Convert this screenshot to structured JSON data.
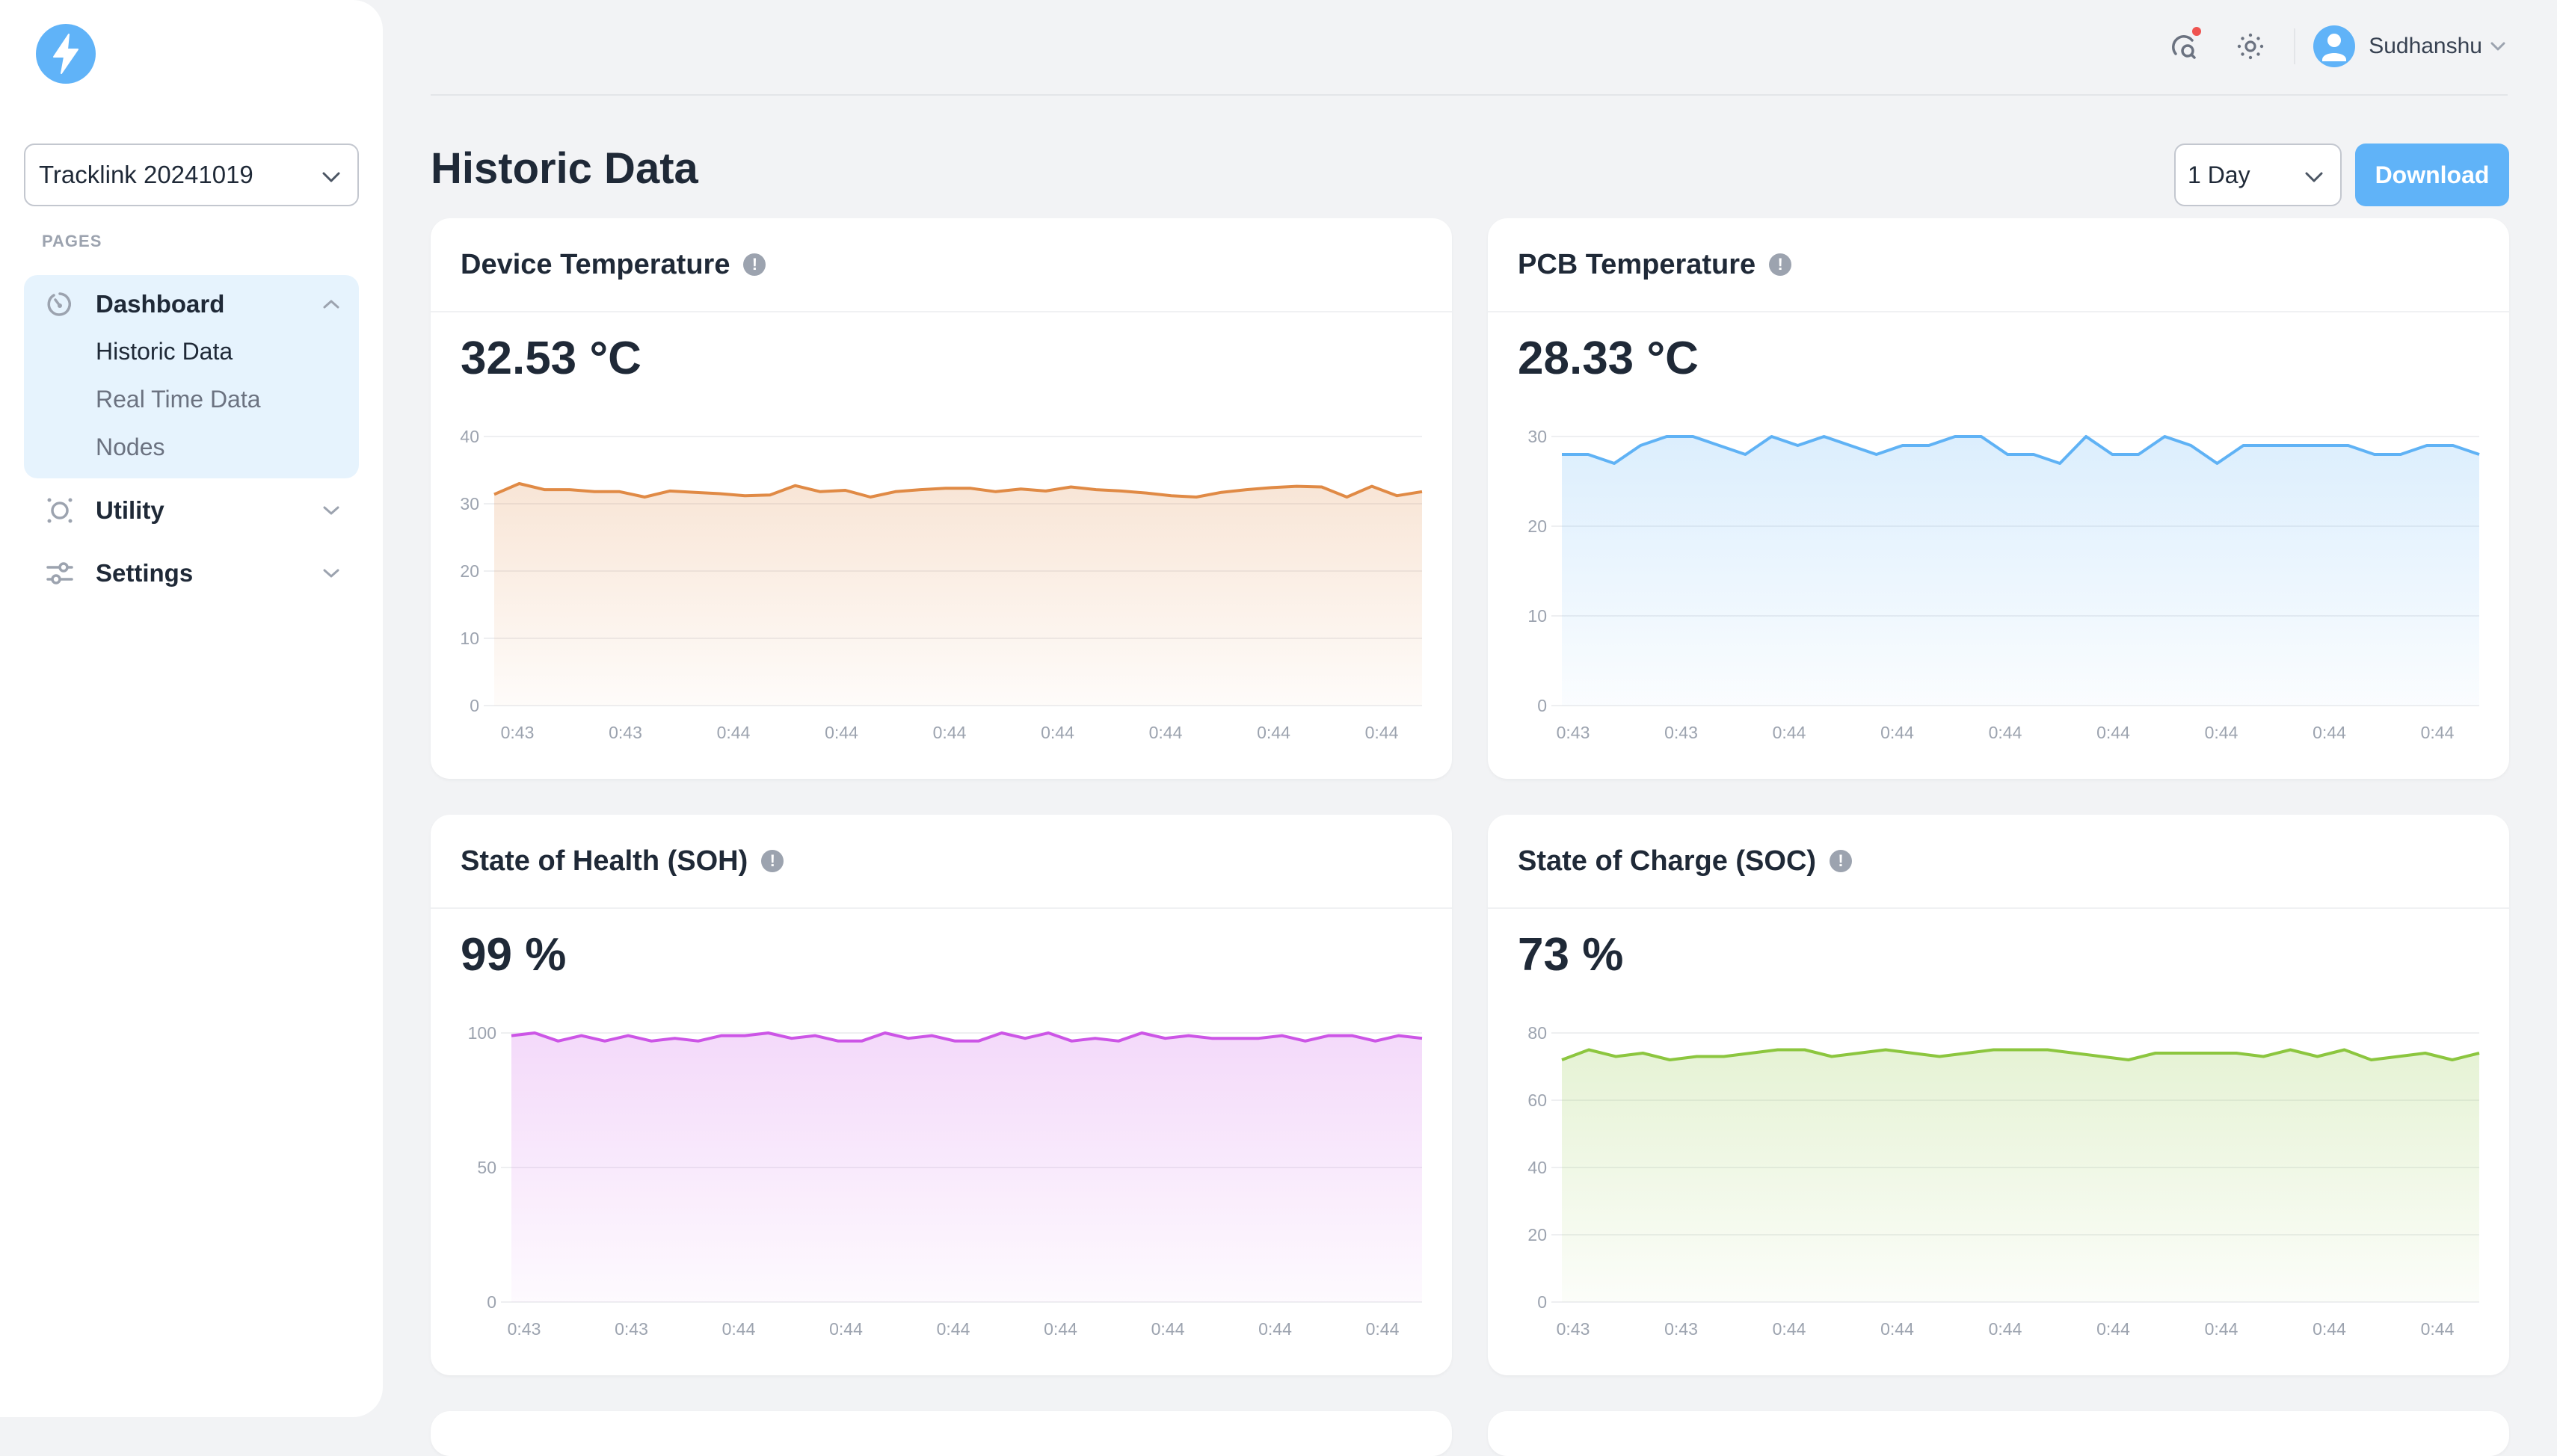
{
  "sidebar": {
    "logo_icon": "lightning-bolt-icon",
    "project_select": {
      "value": "Tracklink 20241019"
    },
    "section_label": "PAGES",
    "nav": [
      {
        "label": "Dashboard",
        "icon": "dashboard-gauge-icon",
        "expanded": true,
        "children": [
          {
            "label": "Historic Data",
            "active": true
          },
          {
            "label": "Real Time Data",
            "active": false
          },
          {
            "label": "Nodes",
            "active": false
          }
        ]
      },
      {
        "label": "Utility",
        "icon": "utility-icon",
        "expanded": false
      },
      {
        "label": "Settings",
        "icon": "sliders-icon",
        "expanded": false
      }
    ]
  },
  "topbar": {
    "user_name": "Sudhanshu",
    "notification_badge": true
  },
  "page": {
    "title": "Historic Data",
    "range_select": {
      "value": "1 Day"
    },
    "download_label": "Download"
  },
  "colors": {
    "accent": "#60b3f8",
    "device_temp": "#e08a45",
    "pcb_temp": "#5fb2f5",
    "soh": "#cc55e6",
    "soc": "#8cc63f"
  },
  "cards": [
    {
      "title": "Device Temperature",
      "value": "32.53 °C"
    },
    {
      "title": "PCB Temperature",
      "value": "28.33 °C"
    },
    {
      "title": "State of Health (SOH)",
      "value": "99 %"
    },
    {
      "title": "State of Charge (SOC)",
      "value": "73 %"
    }
  ],
  "chart_data": [
    {
      "type": "area",
      "title": "Device Temperature",
      "xlabel": "",
      "ylabel": "",
      "ylim": [
        0,
        40
      ],
      "yticks": [
        0,
        10,
        20,
        30,
        40
      ],
      "x_tick_labels": [
        "0:43",
        "0:43",
        "0:44",
        "0:44",
        "0:44",
        "0:44",
        "0:44",
        "0:44",
        "0:44"
      ],
      "grid": true,
      "series": [
        {
          "name": "Device Temperature",
          "color": "#e08a45",
          "values": [
            31.4,
            33.0,
            32.1,
            32.1,
            31.8,
            31.8,
            31.0,
            31.9,
            31.7,
            31.5,
            31.2,
            31.3,
            32.7,
            31.8,
            32.0,
            31.0,
            31.8,
            32.1,
            32.3,
            32.3,
            31.8,
            32.2,
            31.9,
            32.5,
            32.1,
            31.9,
            31.6,
            31.2,
            31.0,
            31.7,
            32.1,
            32.4,
            32.6,
            32.5,
            31.0,
            32.6,
            31.2,
            31.8
          ]
        }
      ]
    },
    {
      "type": "area",
      "title": "PCB Temperature",
      "xlabel": "",
      "ylabel": "",
      "ylim": [
        0,
        30
      ],
      "yticks": [
        0,
        10,
        20,
        30
      ],
      "x_tick_labels": [
        "0:43",
        "0:43",
        "0:44",
        "0:44",
        "0:44",
        "0:44",
        "0:44",
        "0:44",
        "0:44"
      ],
      "grid": true,
      "series": [
        {
          "name": "PCB Temperature",
          "color": "#5fb2f5",
          "values": [
            28,
            28,
            27,
            29,
            30,
            30,
            29,
            28,
            30,
            29,
            30,
            29,
            28,
            29,
            29,
            30,
            30,
            28,
            28,
            27,
            30,
            28,
            28,
            30,
            29,
            27,
            29,
            29,
            29,
            29,
            29,
            28,
            28,
            29,
            29,
            28
          ]
        }
      ]
    },
    {
      "type": "area",
      "title": "State of Health (SOH)",
      "xlabel": "",
      "ylabel": "",
      "ylim": [
        0,
        100
      ],
      "yticks": [
        0,
        50,
        100
      ],
      "x_tick_labels": [
        "0:43",
        "0:43",
        "0:44",
        "0:44",
        "0:44",
        "0:44",
        "0:44",
        "0:44",
        "0:44"
      ],
      "grid": true,
      "series": [
        {
          "name": "SOH",
          "color": "#cc55e6",
          "values": [
            99,
            100,
            97,
            99,
            97,
            99,
            97,
            98,
            97,
            99,
            99,
            100,
            98,
            99,
            97,
            97,
            100,
            98,
            99,
            97,
            97,
            100,
            98,
            100,
            97,
            98,
            97,
            100,
            98,
            99,
            98,
            98,
            98,
            99,
            97,
            99,
            99,
            97,
            99,
            98
          ]
        }
      ]
    },
    {
      "type": "area",
      "title": "State of Charge (SOC)",
      "xlabel": "",
      "ylabel": "",
      "ylim": [
        0,
        80
      ],
      "yticks": [
        0,
        20,
        40,
        60,
        80
      ],
      "x_tick_labels": [
        "0:43",
        "0:43",
        "0:44",
        "0:44",
        "0:44",
        "0:44",
        "0:44",
        "0:44",
        "0:44"
      ],
      "grid": true,
      "series": [
        {
          "name": "SOC",
          "color": "#8cc63f",
          "values": [
            72,
            75,
            73,
            74,
            72,
            73,
            73,
            74,
            75,
            75,
            73,
            74,
            75,
            74,
            73,
            74,
            75,
            75,
            75,
            74,
            73,
            72,
            74,
            74,
            74,
            74,
            73,
            75,
            73,
            75,
            72,
            73,
            74,
            72,
            74
          ]
        }
      ]
    }
  ]
}
